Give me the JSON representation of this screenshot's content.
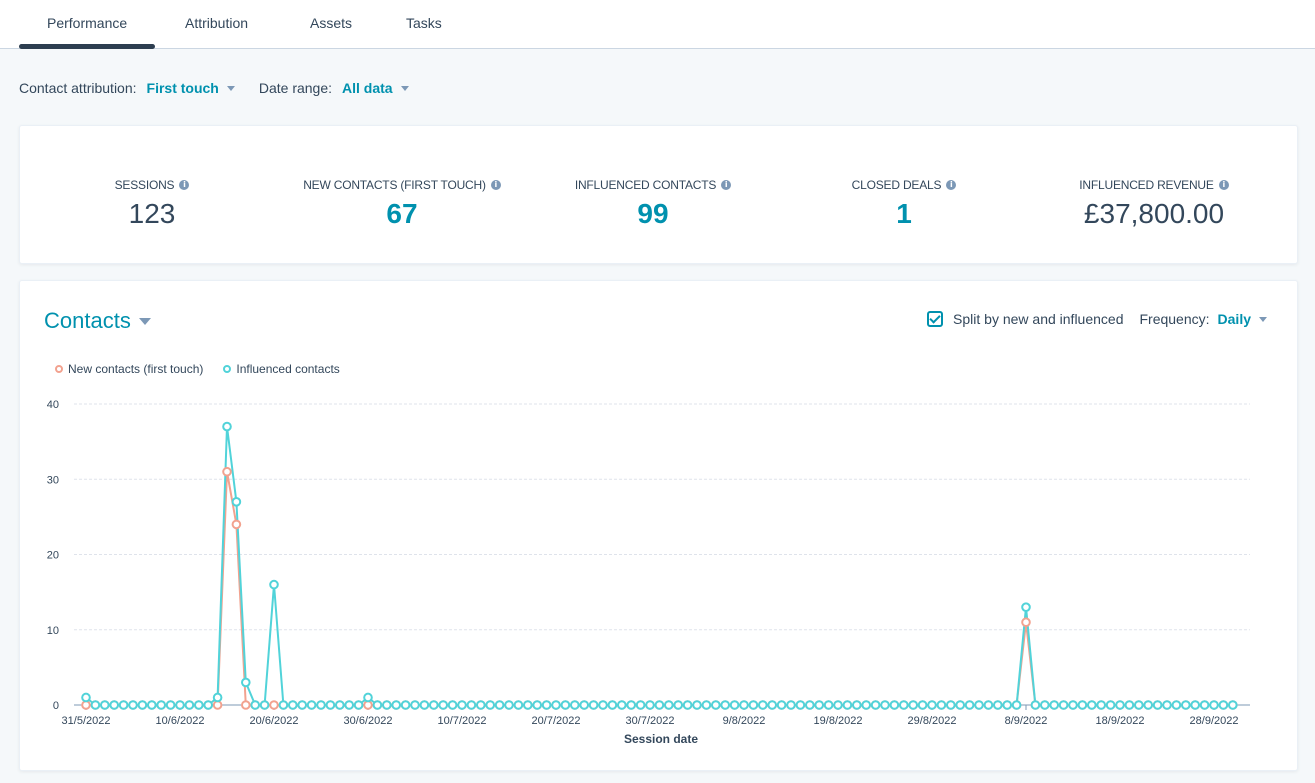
{
  "tabs": [
    {
      "label": "Performance",
      "active": true
    },
    {
      "label": "Attribution",
      "active": false
    },
    {
      "label": "Assets",
      "active": false
    },
    {
      "label": "Tasks",
      "active": false
    }
  ],
  "filters": {
    "contact_attribution_label": "Contact attribution:",
    "contact_attribution_value": "First touch",
    "date_range_label": "Date range:",
    "date_range_value": "All data"
  },
  "kpis": [
    {
      "label": "SESSIONS",
      "value": "123",
      "accent": false
    },
    {
      "label": "NEW CONTACTS (FIRST TOUCH)",
      "value": "67",
      "accent": true
    },
    {
      "label": "INFLUENCED CONTACTS",
      "value": "99",
      "accent": true
    },
    {
      "label": "CLOSED DEALS",
      "value": "1",
      "accent": true
    },
    {
      "label": "INFLUENCED REVENUE",
      "value": "£37,800.00",
      "accent": false
    }
  ],
  "chart_card": {
    "title": "Contacts",
    "split_checkbox_label": "Split by new and influenced",
    "split_checked": true,
    "frequency_label": "Frequency:",
    "frequency_value": "Daily"
  },
  "colors": {
    "accent": "#0091ae",
    "new_contacts": "#f2a28f",
    "influenced_contacts": "#51d3d9",
    "text": "#33475b"
  },
  "chart_data": {
    "type": "line",
    "title": "Contacts",
    "xlabel": "Session date",
    "ylabel": "",
    "ylim": [
      0,
      40
    ],
    "yticks": [
      0,
      10,
      20,
      30,
      40
    ],
    "grid": true,
    "legend_position": "top-left",
    "x_start": "31/5/2022",
    "x_end": "30/9/2022",
    "x_step": "1 day",
    "num_points": 123,
    "xtick_labels": [
      "31/5/2022",
      "10/6/2022",
      "20/6/2022",
      "30/6/2022",
      "10/7/2022",
      "20/7/2022",
      "30/7/2022",
      "9/8/2022",
      "19/8/2022",
      "29/8/2022",
      "8/9/2022",
      "18/9/2022",
      "28/9/2022"
    ],
    "xtick_day_index": [
      0,
      10,
      20,
      30,
      40,
      50,
      60,
      70,
      80,
      90,
      100,
      110,
      120
    ],
    "series": [
      {
        "name": "New contacts (first touch)",
        "color": "#f2a28f",
        "nonzero": {
          "15": 31,
          "16": 24,
          "100": 11
        }
      },
      {
        "name": "Influenced contacts",
        "color": "#51d3d9",
        "nonzero": {
          "0": 1,
          "14": 1,
          "15": 37,
          "16": 27,
          "17": 3,
          "20": 16,
          "30": 1,
          "100": 13
        }
      }
    ]
  }
}
